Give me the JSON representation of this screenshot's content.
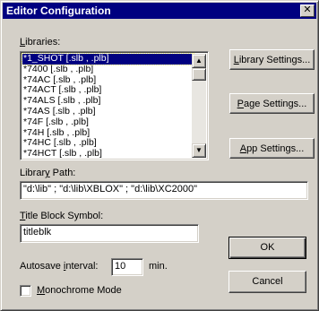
{
  "dialog": {
    "title": "Editor Configuration",
    "close_glyph": "✕"
  },
  "libraries": {
    "label_pre": "",
    "label_key": "L",
    "label_post": "ibraries:",
    "items": [
      "*1_SHOT [.slb , .plb]",
      "*7400 [.slb , .plb]",
      "*74AC [.slb , .plb]",
      "*74ACT [.slb , .plb]",
      "*74ALS [.slb , .plb]",
      "*74AS [.slb , .plb]",
      "*74F [.slb , .plb]",
      "*74H [.slb , .plb]",
      "*74HC [.slb , .plb]",
      "*74HCT [.slb , .plb]"
    ],
    "selected_index": 0
  },
  "buttons": {
    "library_settings": {
      "pre": "",
      "key": "L",
      "post": "ibrary Settings..."
    },
    "page_settings": {
      "pre": "",
      "key": "P",
      "post": "age Settings..."
    },
    "app_settings": {
      "pre": "",
      "key": "A",
      "post": "pp Settings..."
    },
    "ok": "OK",
    "cancel": "Cancel"
  },
  "library_path": {
    "label_pre": "Librar",
    "label_key": "y",
    "label_post": " Path:",
    "value": "\"d:\\lib\" ; \"d:\\lib\\XBLOX\" ; \"d:\\lib\\XC2000\""
  },
  "title_block": {
    "label_pre": "",
    "label_key": "T",
    "label_post": "itle Block Symbol:",
    "value": "titleblk"
  },
  "autosave": {
    "label_pre": "Autosave ",
    "label_key": "i",
    "label_post": "nterval:",
    "value": "10",
    "unit": "min."
  },
  "monochrome": {
    "label_pre": "",
    "label_key": "M",
    "label_post": "onochrome Mode",
    "checked": false
  },
  "icons": {
    "scroll_up": "▲",
    "scroll_down": "▼"
  }
}
